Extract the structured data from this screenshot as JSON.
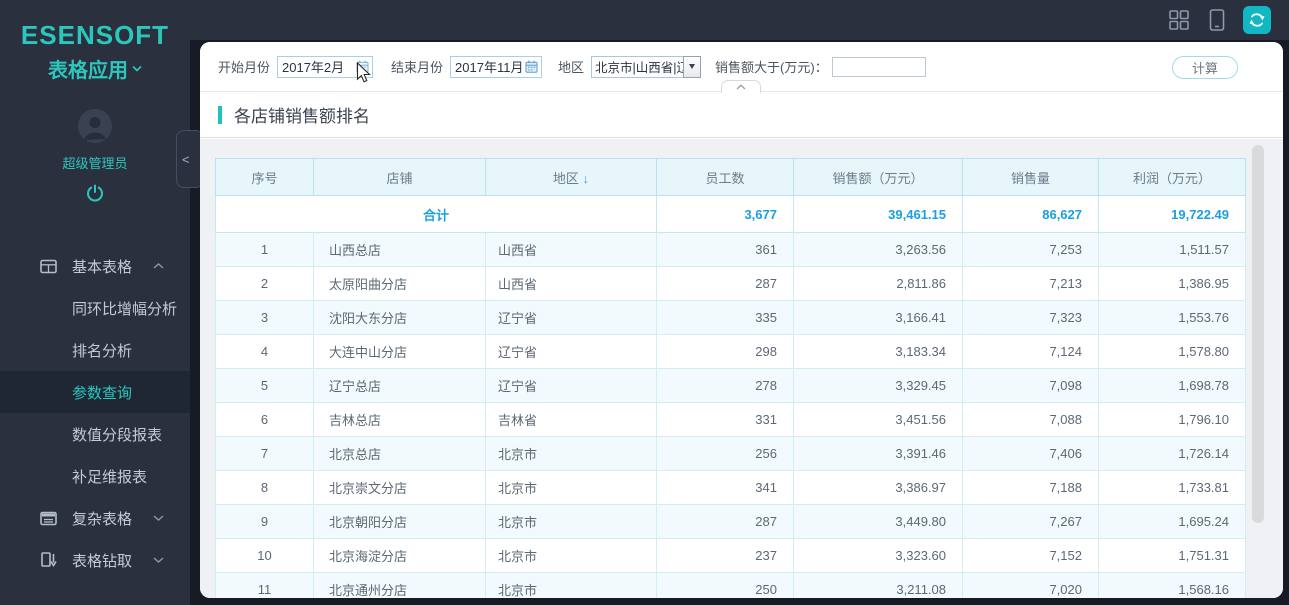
{
  "colors": {
    "accent_teal": "#2cc7bc",
    "refresh_button_bg": "#12b7c4",
    "link_blue": "#189fe4",
    "table_header_bg": "#e6f6fb",
    "table_border": "#b7e3ef",
    "sidebar_bg": "#2a303e",
    "page_bg": "#161b25",
    "active_item_bg": "#202734",
    "title_accent": "#1ec1c1"
  },
  "topbar": {
    "icons": [
      "grid-layout-icon",
      "device-preview-icon",
      "refresh-icon"
    ]
  },
  "sidebar": {
    "logo_title": "ESENSOFT",
    "logo_subtitle": "表格应用",
    "user_name": "超级管理员",
    "collapse_glyph": "<",
    "menu": [
      {
        "id": "basic-tables",
        "label": "基本表格",
        "level": 0,
        "icon": "table-icon",
        "chevron": "up",
        "active": false
      },
      {
        "id": "yoy-analysis",
        "label": "同环比增幅分析",
        "level": 1,
        "active": false
      },
      {
        "id": "ranking-analysis",
        "label": "排名分析",
        "level": 1,
        "active": false
      },
      {
        "id": "param-query",
        "label": "参数查询",
        "level": 1,
        "active": true
      },
      {
        "id": "numeric-segment",
        "label": "数值分段报表",
        "level": 1,
        "active": false
      },
      {
        "id": "complete-dim",
        "label": "补足维报表",
        "level": 1,
        "active": false
      },
      {
        "id": "complex-tables",
        "label": "复杂表格",
        "level": 0,
        "icon": "report-icon",
        "chevron": "down",
        "active": false
      },
      {
        "id": "table-drill",
        "label": "表格钻取",
        "level": 0,
        "icon": "drill-icon",
        "chevron": "down",
        "active": false
      }
    ]
  },
  "filters": {
    "start_month_label": "开始月份",
    "start_month_value": "2017年2月",
    "end_month_label": "结束月份",
    "end_month_value": "2017年11月",
    "region_label": "地区",
    "region_value": "北京市|山西省|辽",
    "sales_gt_label": "销售额大于(万元)：",
    "sales_gt_value": "",
    "calc_button": "计算"
  },
  "report": {
    "title": "各店铺销售额排名"
  },
  "table": {
    "columns": [
      {
        "label": "序号"
      },
      {
        "label": "店铺"
      },
      {
        "label": "地区",
        "sort": "↓"
      },
      {
        "label": "员工数"
      },
      {
        "label": "销售额（万元）"
      },
      {
        "label": "销售量"
      },
      {
        "label": "利润（万元）"
      }
    ],
    "summary": {
      "label": "合计",
      "values": [
        "3,677",
        "39,461.15",
        "86,627",
        "19,722.49"
      ]
    },
    "rows": [
      [
        "1",
        "山西总店",
        "山西省",
        "361",
        "3,263.56",
        "7,253",
        "1,511.57"
      ],
      [
        "2",
        "太原阳曲分店",
        "山西省",
        "287",
        "2,811.86",
        "7,213",
        "1,386.95"
      ],
      [
        "3",
        "沈阳大东分店",
        "辽宁省",
        "335",
        "3,166.41",
        "7,323",
        "1,553.76"
      ],
      [
        "4",
        "大连中山分店",
        "辽宁省",
        "298",
        "3,183.34",
        "7,124",
        "1,578.80"
      ],
      [
        "5",
        "辽宁总店",
        "辽宁省",
        "278",
        "3,329.45",
        "7,098",
        "1,698.78"
      ],
      [
        "6",
        "吉林总店",
        "吉林省",
        "331",
        "3,451.56",
        "7,088",
        "1,796.10"
      ],
      [
        "7",
        "北京总店",
        "北京市",
        "256",
        "3,391.46",
        "7,406",
        "1,726.14"
      ],
      [
        "8",
        "北京崇文分店",
        "北京市",
        "341",
        "3,386.97",
        "7,188",
        "1,733.81"
      ],
      [
        "9",
        "北京朝阳分店",
        "北京市",
        "287",
        "3,449.80",
        "7,267",
        "1,695.24"
      ],
      [
        "10",
        "北京海淀分店",
        "北京市",
        "237",
        "3,323.60",
        "7,152",
        "1,751.31"
      ],
      [
        "11",
        "北京通州分店",
        "北京市",
        "250",
        "3,211.08",
        "7,020",
        "1,568.16"
      ]
    ]
  }
}
